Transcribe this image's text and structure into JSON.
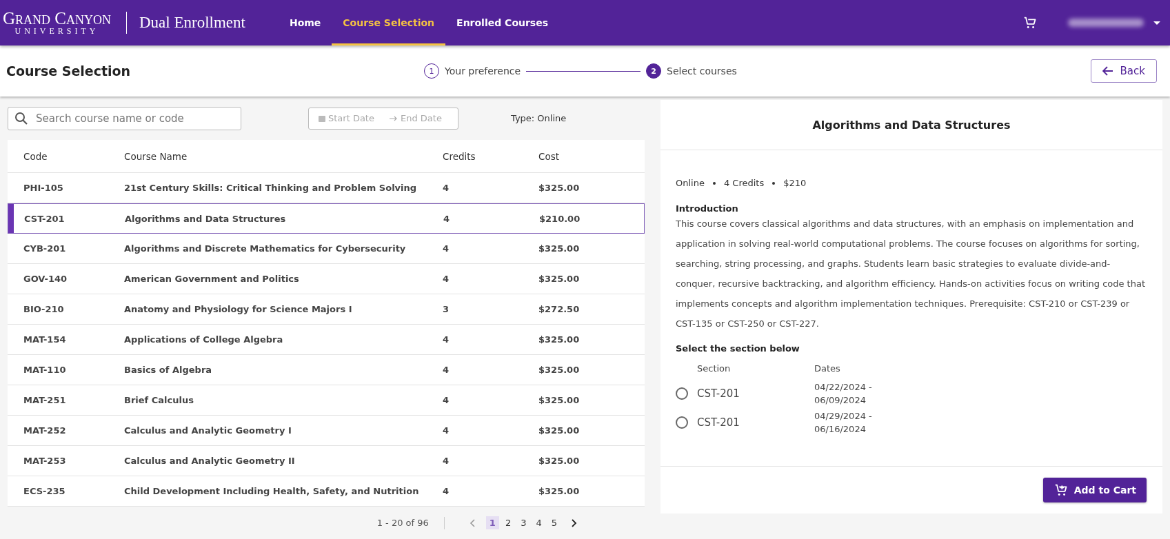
{
  "header": {
    "logo_top": "Grand Canyon",
    "logo_bottom": "UNIVERSITY",
    "app_title": "Dual Enrollment",
    "nav": [
      {
        "label": "Home",
        "selected": false
      },
      {
        "label": "Course Selection",
        "selected": true
      },
      {
        "label": "Enrolled Courses",
        "selected": false
      }
    ]
  },
  "subheader": {
    "title": "Course Selection",
    "steps": [
      {
        "number": "1",
        "label": "Your preference",
        "selected": false
      },
      {
        "number": "2",
        "label": "Select courses",
        "selected": true
      }
    ],
    "back_button": "Back"
  },
  "filters": {
    "search": {
      "placeholder": "Search course name or code"
    },
    "start_date": {
      "placeholder": "Start Date"
    },
    "end_date": {
      "placeholder": "End Date"
    },
    "type": "Type: Online"
  },
  "table": {
    "columns": [
      "Code",
      "Course Name",
      "Credits",
      "Cost"
    ],
    "rows": [
      {
        "code": "PHI-105",
        "name": "21st Century Skills: Critical Thinking and Problem Solving",
        "credits": "4",
        "cost": "$325.00",
        "selected": false
      },
      {
        "code": "CST-201",
        "name": "Algorithms and Data Structures",
        "credits": "4",
        "cost": "$210.00",
        "selected": true
      },
      {
        "code": "CYB-201",
        "name": "Algorithms and Discrete Mathematics for Cybersecurity",
        "credits": "4",
        "cost": "$325.00",
        "selected": false
      },
      {
        "code": "GOV-140",
        "name": "American Government and Politics",
        "credits": "4",
        "cost": "$325.00",
        "selected": false
      },
      {
        "code": "BIO-210",
        "name": "Anatomy and Physiology for Science Majors I",
        "credits": "3",
        "cost": "$272.50",
        "selected": false
      },
      {
        "code": "MAT-154",
        "name": "Applications of College Algebra",
        "credits": "4",
        "cost": "$325.00",
        "selected": false
      },
      {
        "code": "MAT-110",
        "name": "Basics of Algebra",
        "credits": "4",
        "cost": "$325.00",
        "selected": false
      },
      {
        "code": "MAT-251",
        "name": "Brief Calculus",
        "credits": "4",
        "cost": "$325.00",
        "selected": false
      },
      {
        "code": "MAT-252",
        "name": "Calculus and Analytic Geometry I",
        "credits": "4",
        "cost": "$325.00",
        "selected": false
      },
      {
        "code": "MAT-253",
        "name": "Calculus and Analytic Geometry II",
        "credits": "4",
        "cost": "$325.00",
        "selected": false
      },
      {
        "code": "ECS-235",
        "name": "Child Development Including Health, Safety, and Nutrition",
        "credits": "4",
        "cost": "$325.00",
        "selected": false
      }
    ]
  },
  "pagination": {
    "range": "1 - 20 of 96",
    "pages": [
      {
        "label": "1",
        "selected": true
      },
      {
        "label": "2",
        "selected": false
      },
      {
        "label": "3",
        "selected": false
      },
      {
        "label": "4",
        "selected": false
      },
      {
        "label": "5",
        "selected": false
      }
    ]
  },
  "detail": {
    "title": "Algorithms and Data Structures",
    "meta": [
      "Online",
      "4 Credits",
      "$210"
    ],
    "intro_heading": "Introduction",
    "intro": "This course covers classical algorithms and data structures, with an emphasis on implementation and application in solving real-world computational problems. The course focuses on algorithms for sorting, searching, string processing, and graphs. Students learn basic strategies to evaluate divide-and-conquer, recursive backtracking, and algorithm efficiency. Hands-on activities focus on writing code that implements concepts and algorithm implementation techniques. Prerequisite: CST-210 or CST-239 or CST-135 or CST-250 or CST-227.",
    "section_heading": "Select the section below",
    "section_columns": [
      "Section",
      "Dates"
    ],
    "sections": [
      {
        "section": "CST-201",
        "dates": "04/22/2024 - 06/09/2024",
        "selected": false
      },
      {
        "section": "CST-201",
        "dates": "04/29/2024 - 06/16/2024",
        "selected": false
      }
    ],
    "add_button": "Add to Cart"
  }
}
